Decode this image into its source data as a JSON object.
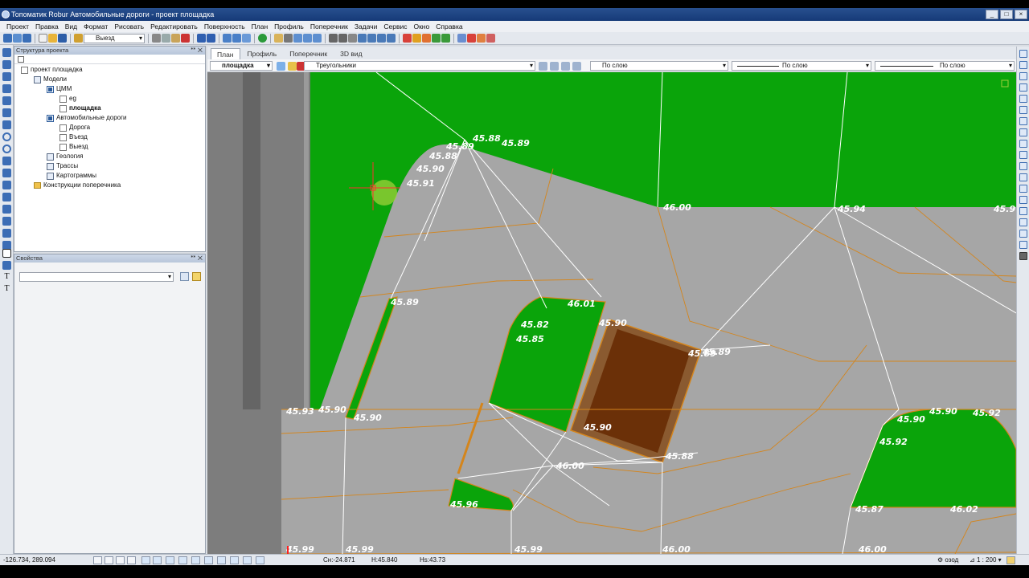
{
  "window": {
    "title": "Топоматик Robur Автомобильные дороги - проект площадка"
  },
  "menu": [
    "Проект",
    "Правка",
    "Вид",
    "Формат",
    "Рисовать",
    "Редактировать",
    "Поверхность",
    "План",
    "Профиль",
    "Поперечник",
    "Задачи",
    "Сервис",
    "Окно",
    "Справка"
  ],
  "toolbar": {
    "layer_value": "Выезд"
  },
  "project_panel": {
    "title": "Структура проекта",
    "tree": {
      "root": "проект площадка",
      "models": "Модели",
      "cmm": "ЦММ",
      "eg": "eg",
      "site": "площадка",
      "roads": "Автомобильные дороги",
      "road": "Дорога",
      "entry": "Въезд",
      "exit": "Выезд",
      "geology": "Геология",
      "routes": "Трассы",
      "cartograms": "Картограммы",
      "cross_sections": "Конструкции поперечника"
    }
  },
  "props_panel": {
    "title": "Свойства"
  },
  "view_tabs": [
    "План",
    "Профиль",
    "Поперечник",
    "3D вид"
  ],
  "view_toolbar": {
    "surface": "площадка",
    "mode": "Треугольники",
    "color": "По слою",
    "linetype": "По слою",
    "lineweight": "По слою"
  },
  "elevations": {
    "e1": "45.89",
    "e2": "45.88",
    "e3": "45.89",
    "e4": "45.88",
    "e5": "45.90",
    "e6": "45.91",
    "e7": "46.00",
    "e8": "45.94",
    "e9": "45.9",
    "e10": "45.89",
    "e11": "46.01",
    "e12": "45.82",
    "e13": "45.85",
    "e14": "45.90",
    "e15": "45.89",
    "e16": "45.93",
    "e17": "45.90",
    "e18": "45.90",
    "e19": "45.90",
    "e20": "45.88",
    "e21": "46.00",
    "e22": "45.99",
    "e23": "45.99",
    "e24": "45.99",
    "e25": "46.00",
    "e26": "46.00",
    "e27": "45.96",
    "e28": "45.87",
    "e29": "46.02",
    "e30": "45.90",
    "e31": "45.90",
    "e32": "45.92",
    "e33": "45.92",
    "e34": "45.89"
  },
  "status": {
    "coords": "-126.734, 289.094",
    "offset": "Сн:-24.871",
    "height": "Н:45.840",
    "hs": "Нs:43.73",
    "snap": "озод",
    "scale": "1 : 200"
  },
  "colors": {
    "grass": "#0aa40a",
    "pavement": "#a6a6a6",
    "building": "#6b3008",
    "contour": "#d4851c",
    "triangle": "#ffffff"
  }
}
